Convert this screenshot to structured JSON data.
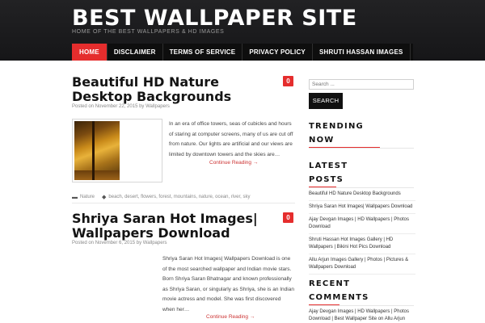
{
  "site": {
    "title": "BEST WALLPAPER SITE",
    "tagline": "HOME OF THE BEST WALLPAPERS & HD IMAGES"
  },
  "nav": {
    "items": [
      "HOME",
      "DISCLAIMER",
      "TERMS OF SERVICE",
      "PRIVACY POLICY",
      "SHRUTI HASSAN IMAGES"
    ],
    "active": "HOME"
  },
  "posts": [
    {
      "title": "Beautiful HD Nature Desktop Backgrounds",
      "comments": "0",
      "meta_prefix": "Posted on",
      "date": "November 22, 2015",
      "meta_by": "by",
      "author": "Wallpapers",
      "excerpt": "In an era of office towers, seas of cubicles and hours of staring at computer screens, many of us are cut off from nature. Our lights are artificial and our views are limited by downtown towers and the skies are…",
      "read_more": "Continue Reading →",
      "category": "Nature",
      "tags": "beach, desert, flowers, forest, mountains, nature, ocean, river, sky"
    },
    {
      "title": "Shriya Saran Hot Images| Wallpapers Download",
      "comments": "0",
      "meta_prefix": "Posted on",
      "date": "November 6, 2015",
      "meta_by": "by",
      "author": "Wallpapers",
      "excerpt": "Shriya Saran Hot Images| Wallpapers Download is one of the most searched wallpaper and Indian movie stars.  Born Shriya Saran Bhatnagar and known professionally as Shriya Saran, or singularly as Shriya, she is an Indian movie actress and model. She was first discovered when her…",
      "read_more": "Continue Reading →"
    }
  ],
  "sidebar": {
    "search_placeholder": "Search ...",
    "search_button": "SEARCH",
    "trending_title_1": "TRENDING",
    "trending_title_2": "NOW",
    "latest_title_1": "LATEST",
    "latest_title_2": "POSTS",
    "latest_posts": [
      "Beautiful HD Nature Desktop Backgrounds",
      "Shriya Saran Hot Images| Wallpapers Download",
      "Ajay Devgan Images | HD Wallpapers | Photos Download",
      "Shruti Hassan Hot Images Gallery | HD Wallpapers | Bikini Hot Pics Download",
      "Allu Arjun Images Gallery | Photos | Pictures & Wallpapers Download"
    ],
    "recent_title_1": "RECENT",
    "recent_title_2": "COMMENTS",
    "recent_comment": "Ajay Devgan Images | HD Wallpapers | Photos Download | Best Wallpaper Site on Allu Arjun"
  },
  "colors": {
    "accent": "#e52d2d",
    "header_bg": "#1c1c1e",
    "nav_bg": "#0e0e0e"
  },
  "icons": {
    "category": "folder-icon",
    "tags": "tag-icon"
  }
}
